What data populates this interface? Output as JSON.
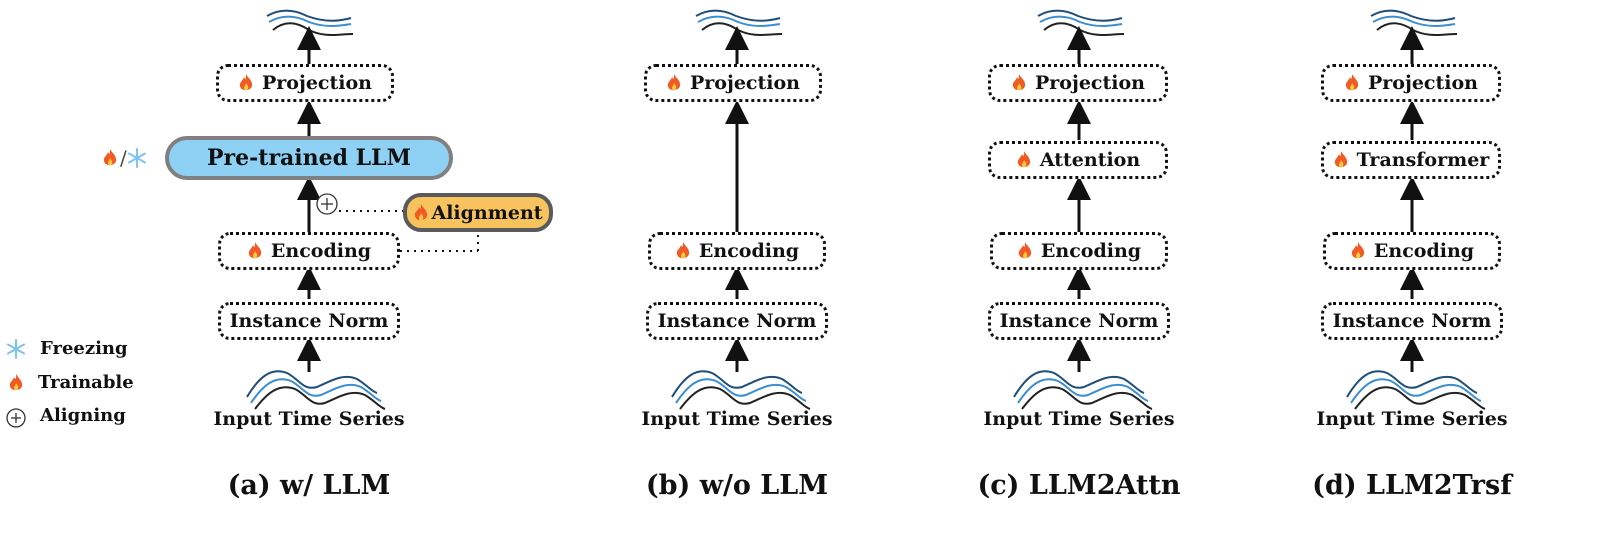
{
  "panels": [
    {
      "id": "a",
      "caption": "(a) w/ LLM",
      "input_label": "Input Time Series",
      "blocks": [
        "Instance Norm",
        "Encoding",
        "Pre-trained LLM",
        "Projection"
      ],
      "alignment_label": "Alignment",
      "llm_state": "🔥/❄️"
    },
    {
      "id": "b",
      "caption": "(b) w/o LLM",
      "input_label": "Input Time Series",
      "blocks": [
        "Instance Norm",
        "Encoding",
        "Projection"
      ]
    },
    {
      "id": "c",
      "caption": "(c) LLM2Attn",
      "input_label": "Input Time Series",
      "blocks": [
        "Instance Norm",
        "Encoding",
        "Attention",
        "Projection"
      ]
    },
    {
      "id": "d",
      "caption": "(d) LLM2Trsf",
      "input_label": "Input Time Series",
      "blocks": [
        "Instance Norm",
        "Encoding",
        "Transformer",
        "Projection"
      ]
    }
  ],
  "legend": [
    {
      "icon": "snowflake-icon",
      "label": "Freezing"
    },
    {
      "icon": "fire-icon",
      "label": "Trainable"
    },
    {
      "icon": "circle-plus-icon",
      "label": "Aligning"
    }
  ],
  "colors": {
    "llm_fill": "#8fd0f5",
    "llm_border": "#808080",
    "alignment_fill": "#f6c35f",
    "series_dark_blue": "#1f4e79",
    "series_light_blue": "#3b8fd0",
    "series_black": "#222222",
    "snowflake": "#7cc4f0",
    "fire": "#f05a24"
  }
}
